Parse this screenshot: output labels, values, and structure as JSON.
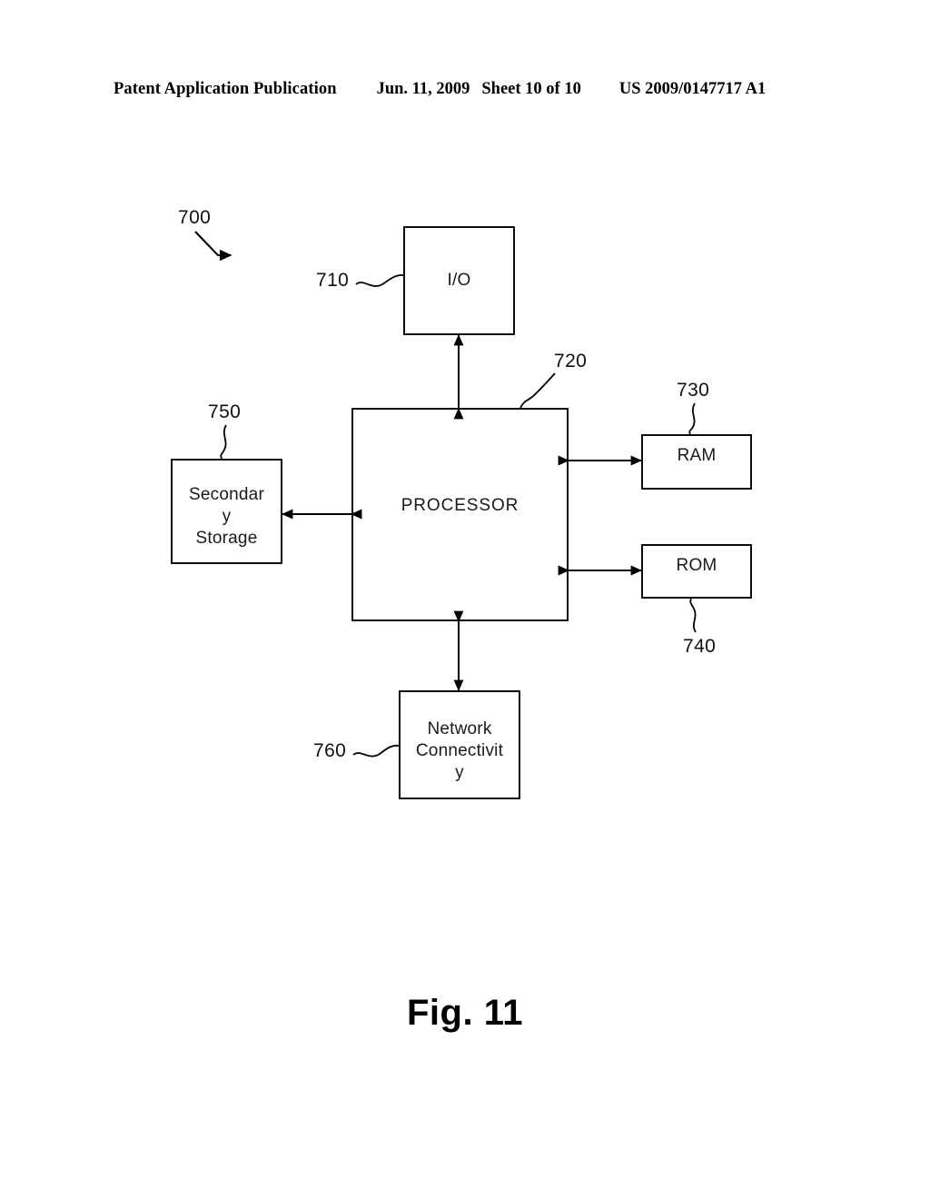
{
  "header": {
    "publication": "Patent Application Publication",
    "date": "Jun. 11, 2009",
    "sheet": "Sheet 10 of 10",
    "patent_number": "US 2009/0147717 A1"
  },
  "figure": {
    "caption": "Fig. 11",
    "system_reference": "700",
    "blocks": [
      {
        "id": "io",
        "label": "I/O",
        "ref": "710"
      },
      {
        "id": "processor",
        "label": "PROCESSOR",
        "ref": "720"
      },
      {
        "id": "ram",
        "label": "RAM",
        "ref": "730"
      },
      {
        "id": "rom",
        "label": "ROM",
        "ref": "740"
      },
      {
        "id": "secondary",
        "label": "Secondar\ny\nStorage",
        "ref": "750"
      },
      {
        "id": "network",
        "label": "Network\nConnectivit\ny",
        "ref": "760"
      }
    ],
    "connections": [
      {
        "from": "processor",
        "to": "io",
        "style": "bidirectional"
      },
      {
        "from": "processor",
        "to": "ram",
        "style": "bidirectional"
      },
      {
        "from": "processor",
        "to": "rom",
        "style": "bidirectional"
      },
      {
        "from": "processor",
        "to": "secondary",
        "style": "bidirectional"
      },
      {
        "from": "processor",
        "to": "network",
        "style": "bidirectional"
      }
    ]
  },
  "colors": {
    "ink": "#000000",
    "paper": "#ffffff"
  }
}
